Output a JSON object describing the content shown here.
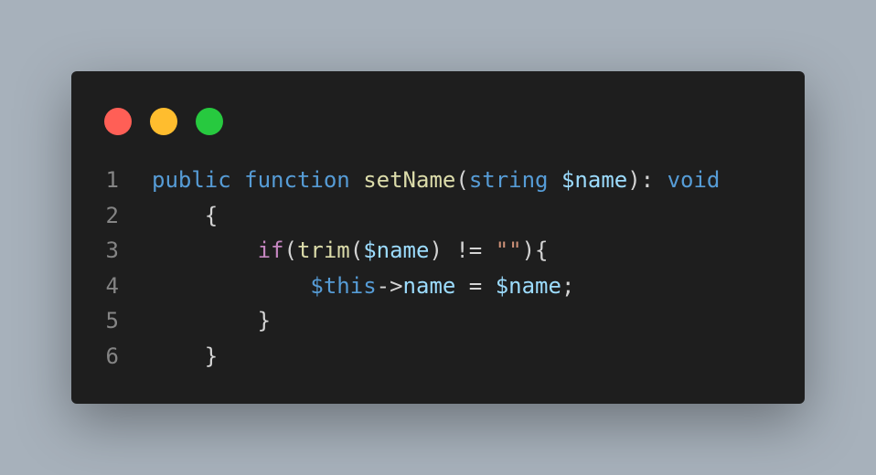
{
  "window": {
    "background": "#1e1e1e",
    "traffic_lights": [
      {
        "name": "close",
        "color": "#ff5f56"
      },
      {
        "name": "minimize",
        "color": "#ffbd2e"
      },
      {
        "name": "maximize",
        "color": "#27c93f"
      }
    ]
  },
  "code": {
    "language": "php",
    "lines": [
      {
        "number": "1",
        "indent": "",
        "tokens": [
          {
            "text": "public",
            "color": "#569cd6"
          },
          {
            "text": " ",
            "color": "#d4d4d4"
          },
          {
            "text": "function",
            "color": "#569cd6"
          },
          {
            "text": " ",
            "color": "#d4d4d4"
          },
          {
            "text": "setName",
            "color": "#dcdcaa"
          },
          {
            "text": "(",
            "color": "#d4d4d4"
          },
          {
            "text": "string",
            "color": "#569cd6"
          },
          {
            "text": " ",
            "color": "#d4d4d4"
          },
          {
            "text": "$name",
            "color": "#9cdcfe"
          },
          {
            "text": "): ",
            "color": "#d4d4d4"
          },
          {
            "text": "void",
            "color": "#569cd6"
          }
        ]
      },
      {
        "number": "2",
        "indent": "    ",
        "tokens": [
          {
            "text": "{",
            "color": "#d4d4d4"
          }
        ]
      },
      {
        "number": "3",
        "indent": "        ",
        "tokens": [
          {
            "text": "if",
            "color": "#c586c0"
          },
          {
            "text": "(",
            "color": "#d4d4d4"
          },
          {
            "text": "trim",
            "color": "#dcdcaa"
          },
          {
            "text": "(",
            "color": "#d4d4d4"
          },
          {
            "text": "$name",
            "color": "#9cdcfe"
          },
          {
            "text": ") != ",
            "color": "#d4d4d4"
          },
          {
            "text": "\"\"",
            "color": "#ce9178"
          },
          {
            "text": "){",
            "color": "#d4d4d4"
          }
        ]
      },
      {
        "number": "4",
        "indent": "            ",
        "tokens": [
          {
            "text": "$this",
            "color": "#569cd6"
          },
          {
            "text": "->",
            "color": "#d4d4d4"
          },
          {
            "text": "name",
            "color": "#9cdcfe"
          },
          {
            "text": " = ",
            "color": "#d4d4d4"
          },
          {
            "text": "$name",
            "color": "#9cdcfe"
          },
          {
            "text": ";",
            "color": "#d4d4d4"
          }
        ]
      },
      {
        "number": "5",
        "indent": "        ",
        "tokens": [
          {
            "text": "}",
            "color": "#d4d4d4"
          }
        ]
      },
      {
        "number": "6",
        "indent": "    ",
        "tokens": [
          {
            "text": "}",
            "color": "#d4d4d4"
          }
        ]
      }
    ]
  }
}
